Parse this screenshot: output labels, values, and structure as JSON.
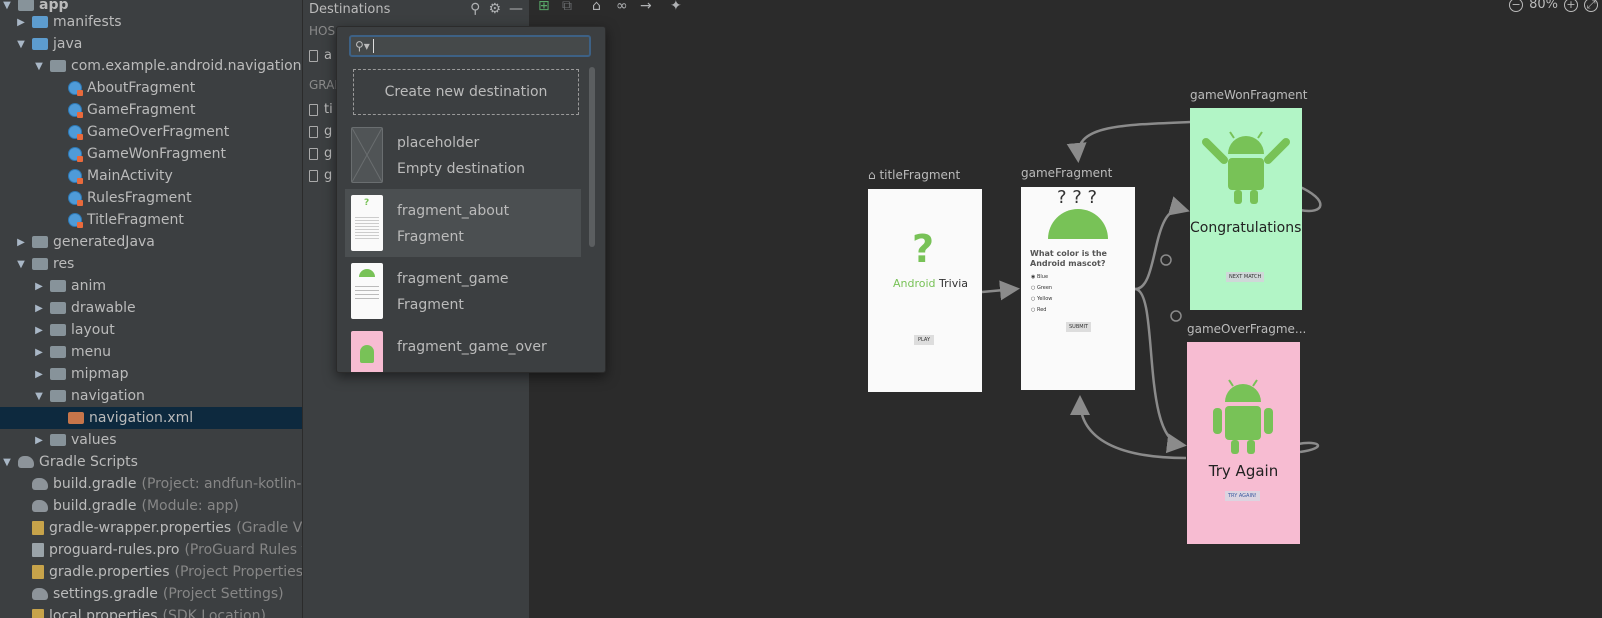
{
  "tree": {
    "items": [
      {
        "label": "app",
        "hint": ""
      },
      {
        "label": "manifests",
        "hint": ""
      },
      {
        "label": "java",
        "hint": ""
      },
      {
        "label": "com.example.android.navigation",
        "hint": ""
      },
      {
        "label": "AboutFragment",
        "hint": ""
      },
      {
        "label": "GameFragment",
        "hint": ""
      },
      {
        "label": "GameOverFragment",
        "hint": ""
      },
      {
        "label": "GameWonFragment",
        "hint": ""
      },
      {
        "label": "MainActivity",
        "hint": ""
      },
      {
        "label": "RulesFragment",
        "hint": ""
      },
      {
        "label": "TitleFragment",
        "hint": ""
      },
      {
        "label": "generatedJava",
        "hint": ""
      },
      {
        "label": "res",
        "hint": ""
      },
      {
        "label": "anim",
        "hint": ""
      },
      {
        "label": "drawable",
        "hint": ""
      },
      {
        "label": "layout",
        "hint": ""
      },
      {
        "label": "menu",
        "hint": ""
      },
      {
        "label": "mipmap",
        "hint": ""
      },
      {
        "label": "navigation",
        "hint": ""
      },
      {
        "label": "navigation.xml",
        "hint": ""
      },
      {
        "label": "values",
        "hint": ""
      },
      {
        "label": "Gradle Scripts",
        "hint": ""
      },
      {
        "label": "build.gradle",
        "hint": "(Project: andfun-kotlin-a"
      },
      {
        "label": "build.gradle",
        "hint": "(Module: app)"
      },
      {
        "label": "gradle-wrapper.properties",
        "hint": "(Gradle Ve"
      },
      {
        "label": "proguard-rules.pro",
        "hint": "(ProGuard Rules f"
      },
      {
        "label": "gradle.properties",
        "hint": "(Project Properties"
      },
      {
        "label": "settings.gradle",
        "hint": "(Project Settings)"
      },
      {
        "label": "local.properties",
        "hint": "(SDK Location)"
      }
    ]
  },
  "destinations": {
    "title": "Destinations",
    "host_section": "HOS",
    "host_item": "a",
    "graph_section": "GRAI",
    "graph_items": [
      "ti",
      "g",
      "g",
      "g"
    ]
  },
  "editor": {
    "zoom": "80%"
  },
  "popup": {
    "search_value": "",
    "create_label": "Create new destination",
    "items": [
      {
        "name": "placeholder",
        "type": "Empty destination"
      },
      {
        "name": "fragment_about",
        "type": "Fragment"
      },
      {
        "name": "fragment_game",
        "type": "Fragment"
      },
      {
        "name": "fragment_game_over",
        "type": ""
      }
    ]
  },
  "graph": {
    "title_fragment": {
      "label": "titleFragment",
      "question": "?",
      "brand_green": "Android",
      "brand_dark": "Trivia",
      "button": "PLAY"
    },
    "game_fragment": {
      "label": "gameFragment",
      "question_marks": "? ? ?",
      "question": "What color is the Android mascot?",
      "options": [
        "Blue",
        "Green",
        "Yellow",
        "Red"
      ],
      "button": "SUBMIT"
    },
    "game_won_fragment": {
      "label": "gameWonFragment",
      "headline": "Congratulations!",
      "button": "NEXT MATCH"
    },
    "game_over_fragment": {
      "label": "gameOverFragme...",
      "headline": "Try Again",
      "button": "TRY AGAIN!"
    }
  },
  "colors": {
    "android_green": "#78c257",
    "won_bg": "#b2f5c6",
    "over_bg": "#f7bcd2"
  }
}
